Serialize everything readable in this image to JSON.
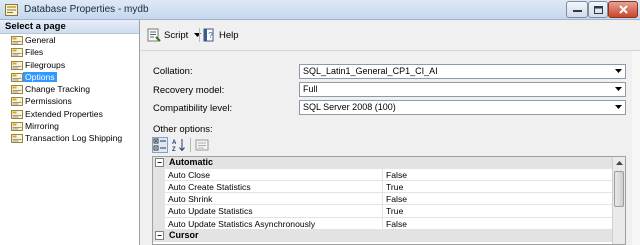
{
  "window": {
    "title": "Database Properties - mydb"
  },
  "left_panel": {
    "header": "Select a page",
    "pages": [
      {
        "label": "General",
        "selected": false
      },
      {
        "label": "Files",
        "selected": false
      },
      {
        "label": "Filegroups",
        "selected": false
      },
      {
        "label": "Options",
        "selected": true
      },
      {
        "label": "Change Tracking",
        "selected": false
      },
      {
        "label": "Permissions",
        "selected": false
      },
      {
        "label": "Extended Properties",
        "selected": false
      },
      {
        "label": "Mirroring",
        "selected": false
      },
      {
        "label": "Transaction Log Shipping",
        "selected": false
      }
    ]
  },
  "toolbar": {
    "script_label": "Script",
    "help_label": "Help"
  },
  "form": {
    "collation_label": "Collation:",
    "collation_value": "SQL_Latin1_General_CP1_CI_AI",
    "recovery_label": "Recovery model:",
    "recovery_value": "Full",
    "compat_label": "Compatibility level:",
    "compat_value": "SQL Server 2008 (100)",
    "other_options_label": "Other options:"
  },
  "property_grid": {
    "categories": [
      {
        "name": "Automatic",
        "expanded": true,
        "properties": [
          {
            "name": "Auto Close",
            "value": "False"
          },
          {
            "name": "Auto Create Statistics",
            "value": "True"
          },
          {
            "name": "Auto Shrink",
            "value": "False"
          },
          {
            "name": "Auto Update Statistics",
            "value": "True"
          },
          {
            "name": "Auto Update Statistics Asynchronously",
            "value": "False"
          }
        ]
      },
      {
        "name": "Cursor",
        "expanded": true,
        "properties": []
      }
    ]
  },
  "colors": {
    "selection": "#3399ff",
    "category_bg": "#e3e3e3"
  },
  "icons": {
    "app": "database-properties-icon",
    "page": "page-properties-icon",
    "script": "script-icon",
    "help": "help-icon",
    "categorized": "categorized-icon",
    "alphabetical": "alphabetical-sort-icon",
    "property_pages": "property-pages-icon"
  }
}
